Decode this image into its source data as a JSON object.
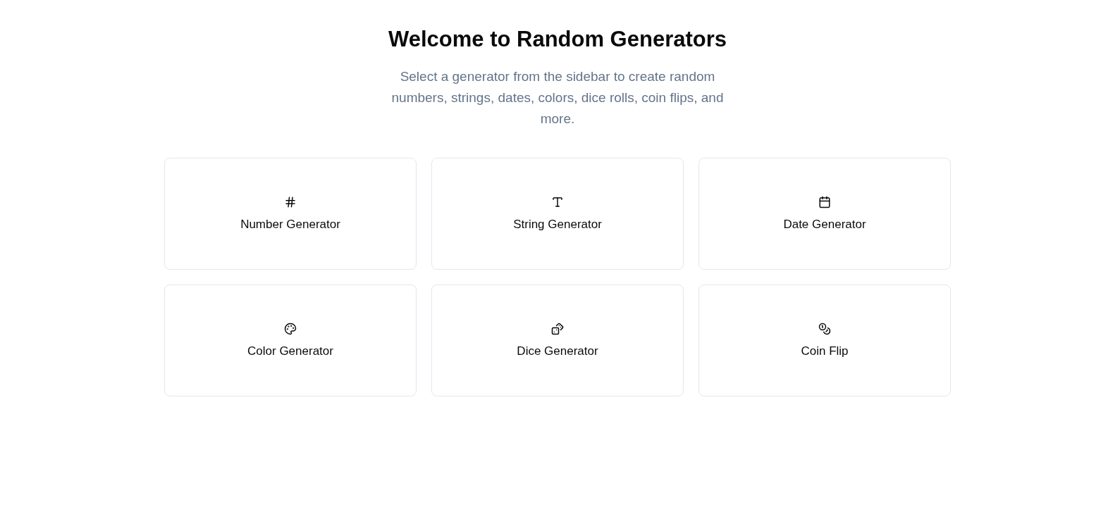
{
  "header": {
    "title": "Welcome to Random Generators",
    "subtitle": "Select a generator from the sidebar to create random numbers, strings, dates, colors, dice rolls, coin flips, and more."
  },
  "generators": [
    {
      "label": "Number Generator"
    },
    {
      "label": "String Generator"
    },
    {
      "label": "Date Generator"
    },
    {
      "label": "Color Generator"
    },
    {
      "label": "Dice Generator"
    },
    {
      "label": "Coin Flip"
    }
  ]
}
